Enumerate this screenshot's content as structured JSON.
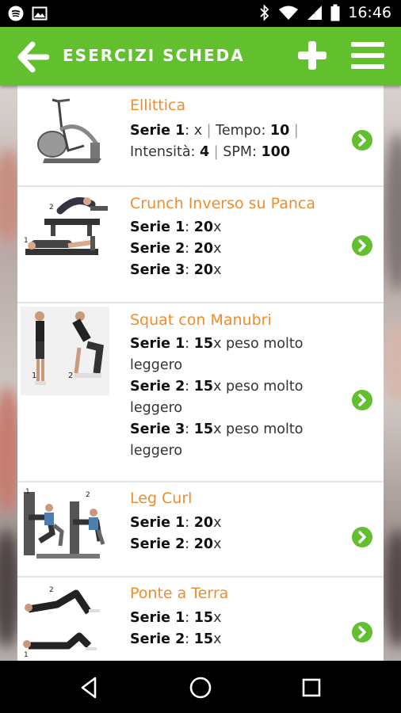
{
  "status_bar": {
    "time": "16:46",
    "left_icons": [
      "spotify-icon",
      "image-icon"
    ],
    "right_icons": [
      "bluetooth-icon",
      "wifi-icon",
      "signal-icon",
      "battery-icon"
    ]
  },
  "app_bar": {
    "title": "ESERCIZI SCHEDA",
    "background": "#62bf2e"
  },
  "exercises": [
    {
      "title": "Ellittica",
      "lines": [
        [
          {
            "b": "Serie 1"
          },
          {
            "t": ": x "
          },
          {
            "s": "|"
          },
          {
            "t": " Tempo: "
          },
          {
            "b": "10"
          },
          {
            "t": " "
          },
          {
            "s": "|"
          }
        ],
        [
          {
            "t": "Intensità: "
          },
          {
            "b": "4"
          },
          {
            "t": " "
          },
          {
            "s": "|"
          },
          {
            "t": " SPM: "
          },
          {
            "b": "100"
          }
        ]
      ]
    },
    {
      "title": "Crunch Inverso su Panca",
      "lines": [
        [
          {
            "b": "Serie 1"
          },
          {
            "t": ": "
          },
          {
            "b": "20"
          },
          {
            "t": "x"
          }
        ],
        [
          {
            "b": "Serie 2"
          },
          {
            "t": ": "
          },
          {
            "b": "20"
          },
          {
            "t": "x"
          }
        ],
        [
          {
            "b": "Serie 3"
          },
          {
            "t": ": "
          },
          {
            "b": "20"
          },
          {
            "t": "x"
          }
        ]
      ]
    },
    {
      "title": "Squat con Manubri",
      "lines": [
        [
          {
            "b": "Serie 1"
          },
          {
            "t": ": "
          },
          {
            "b": "15"
          },
          {
            "t": "x peso molto"
          }
        ],
        [
          {
            "t": "leggero"
          }
        ],
        [
          {
            "b": "Serie 2"
          },
          {
            "t": ": "
          },
          {
            "b": "15"
          },
          {
            "t": "x peso molto"
          }
        ],
        [
          {
            "t": "leggero"
          }
        ],
        [
          {
            "b": "Serie 3"
          },
          {
            "t": ": "
          },
          {
            "b": "15"
          },
          {
            "t": "x peso molto"
          }
        ],
        [
          {
            "t": "leggero"
          }
        ]
      ]
    },
    {
      "title": "Leg Curl",
      "lines": [
        [
          {
            "b": "Serie 1"
          },
          {
            "t": ": "
          },
          {
            "b": "20"
          },
          {
            "t": "x"
          }
        ],
        [
          {
            "b": "Serie 2"
          },
          {
            "t": ": "
          },
          {
            "b": "20"
          },
          {
            "t": "x"
          }
        ]
      ]
    },
    {
      "title": "Ponte a Terra",
      "lines": [
        [
          {
            "b": "Serie 1"
          },
          {
            "t": ": "
          },
          {
            "b": "15"
          },
          {
            "t": "x"
          }
        ],
        [
          {
            "b": "Serie 2"
          },
          {
            "t": ": "
          },
          {
            "b": "15"
          },
          {
            "t": "x"
          }
        ]
      ]
    }
  ],
  "thumb_labels": {
    "crunch": [
      "2",
      "1"
    ],
    "squat": [
      "1",
      "2"
    ],
    "legcurl": [
      "1",
      "2"
    ],
    "ponte": [
      "2",
      "1"
    ]
  },
  "nav_bar": {
    "buttons": [
      "back-triangle-icon",
      "home-circle-icon",
      "recents-square-icon"
    ]
  },
  "colors": {
    "accent_green": "#62bf2e",
    "title_orange": "#ef8c2e"
  }
}
